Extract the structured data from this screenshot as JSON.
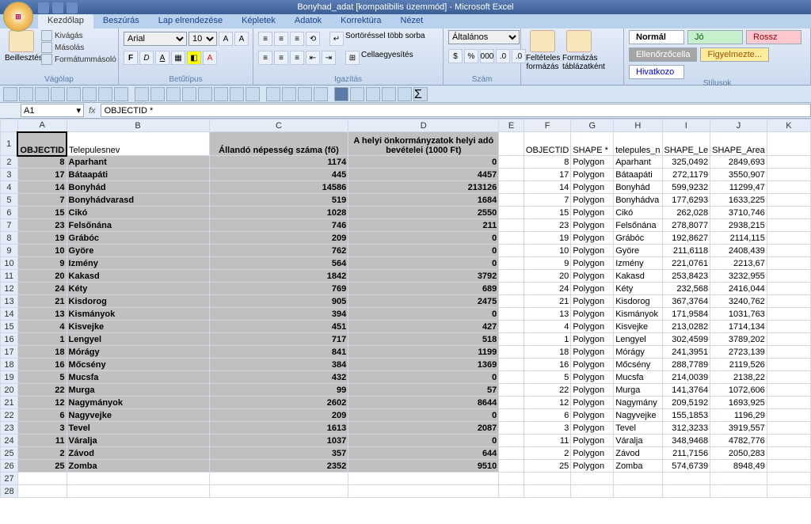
{
  "title": "Bonyhad_adat  [kompatibilis üzemmód] - Microsoft Excel",
  "tabs": [
    "Kezdőlap",
    "Beszúrás",
    "Lap elrendezése",
    "Képletek",
    "Adatok",
    "Korrektúra",
    "Nézet"
  ],
  "active_tab": "Kezdőlap",
  "clipboard": {
    "paste": "Beillesztés",
    "cut": "Kivágás",
    "copy": "Másolás",
    "fmt": "Formátummásoló",
    "label": "Vágólap"
  },
  "font": {
    "name": "Arial",
    "size": "10",
    "label": "Betűtípus"
  },
  "align": {
    "wrap": "Sortöréssel több sorba",
    "merge": "Cellaegyesítés",
    "label": "Igazítás"
  },
  "number": {
    "general": "Általános",
    "label": "Szám"
  },
  "styles": {
    "cond": "Feltételes formázás",
    "table": "Formázás táblázatként",
    "label": "Stílusok",
    "normal": "Normál",
    "jo": "Jó",
    "rossz": "Rossz",
    "ell": "Ellenőrzőcella",
    "fig": "Figyelmezte...",
    "hiv": "Hivatkozo"
  },
  "namebox": "A1",
  "formula": "OBJECTID *",
  "headers": {
    "A": "OBJECTID",
    "B": "Telepulesnev",
    "C": "Állandó népesség száma (fő)",
    "D": "A helyi önkormányzatok helyi adó bevételei (1000 Ft)",
    "F": "OBJECTID",
    "G": "SHAPE *",
    "H": "telepules_n",
    "I": "SHAPE_Le",
    "J": "SHAPE_Area"
  },
  "rows": [
    {
      "r": 2,
      "A": 8,
      "B": "Aparhant",
      "C": 1174,
      "D": 0,
      "F": 8,
      "G": "Polygon",
      "H": "Aparhant",
      "I": "325,0492",
      "J": "2849,693"
    },
    {
      "r": 3,
      "A": 17,
      "B": "Bátaapáti",
      "C": 445,
      "D": 4457,
      "F": 17,
      "G": "Polygon",
      "H": "Bátaapáti",
      "I": "272,1179",
      "J": "3550,907"
    },
    {
      "r": 4,
      "A": 14,
      "B": "Bonyhád",
      "C": 14586,
      "D": 213126,
      "F": 14,
      "G": "Polygon",
      "H": "Bonyhád",
      "I": "599,9232",
      "J": "11299,47"
    },
    {
      "r": 5,
      "A": 7,
      "B": "Bonyhádvarasd",
      "C": 519,
      "D": 1684,
      "F": 7,
      "G": "Polygon",
      "H": "Bonyhádva",
      "I": "177,6293",
      "J": "1633,225"
    },
    {
      "r": 6,
      "A": 15,
      "B": "Cikó",
      "C": 1028,
      "D": 2550,
      "F": 15,
      "G": "Polygon",
      "H": "Cikó",
      "I": "262,028",
      "J": "3710,746"
    },
    {
      "r": 7,
      "A": 23,
      "B": "Felsőnána",
      "C": 746,
      "D": 211,
      "F": 23,
      "G": "Polygon",
      "H": "Felsőnána",
      "I": "278,8077",
      "J": "2938,215"
    },
    {
      "r": 8,
      "A": 19,
      "B": "Grábóc",
      "C": 209,
      "D": 0,
      "F": 19,
      "G": "Polygon",
      "H": "Grábóc",
      "I": "192,8627",
      "J": "2114,115"
    },
    {
      "r": 9,
      "A": 10,
      "B": "Györe",
      "C": 762,
      "D": 0,
      "F": 10,
      "G": "Polygon",
      "H": "Györe",
      "I": "211,6118",
      "J": "2408,439"
    },
    {
      "r": 10,
      "A": 9,
      "B": "Izmény",
      "C": 564,
      "D": 0,
      "F": 9,
      "G": "Polygon",
      "H": "Izmény",
      "I": "221,0761",
      "J": "2213,67"
    },
    {
      "r": 11,
      "A": 20,
      "B": "Kakasd",
      "C": 1842,
      "D": 3792,
      "F": 20,
      "G": "Polygon",
      "H": "Kakasd",
      "I": "253,8423",
      "J": "3232,955"
    },
    {
      "r": 12,
      "A": 24,
      "B": "Kéty",
      "C": 769,
      "D": 689,
      "F": 24,
      "G": "Polygon",
      "H": "Kéty",
      "I": "232,568",
      "J": "2416,044"
    },
    {
      "r": 13,
      "A": 21,
      "B": "Kisdorog",
      "C": 905,
      "D": 2475,
      "F": 21,
      "G": "Polygon",
      "H": "Kisdorog",
      "I": "367,3764",
      "J": "3240,762"
    },
    {
      "r": 14,
      "A": 13,
      "B": "Kismányok",
      "C": 394,
      "D": 0,
      "F": 13,
      "G": "Polygon",
      "H": "Kismányok",
      "I": "171,9584",
      "J": "1031,763"
    },
    {
      "r": 15,
      "A": 4,
      "B": "Kisvejke",
      "C": 451,
      "D": 427,
      "F": 4,
      "G": "Polygon",
      "H": "Kisvejke",
      "I": "213,0282",
      "J": "1714,134"
    },
    {
      "r": 16,
      "A": 1,
      "B": "Lengyel",
      "C": 717,
      "D": 518,
      "F": 1,
      "G": "Polygon",
      "H": "Lengyel",
      "I": "302,4599",
      "J": "3789,202"
    },
    {
      "r": 17,
      "A": 18,
      "B": "Mórágy",
      "C": 841,
      "D": 1199,
      "F": 18,
      "G": "Polygon",
      "H": "Mórágy",
      "I": "241,3951",
      "J": "2723,139"
    },
    {
      "r": 18,
      "A": 16,
      "B": "Mőcsény",
      "C": 384,
      "D": 1369,
      "F": 16,
      "G": "Polygon",
      "H": "Mőcsény",
      "I": "288,7789",
      "J": "2119,526"
    },
    {
      "r": 19,
      "A": 5,
      "B": "Mucsfa",
      "C": 432,
      "D": 0,
      "F": 5,
      "G": "Polygon",
      "H": "Mucsfa",
      "I": "214,0039",
      "J": "2138,22"
    },
    {
      "r": 20,
      "A": 22,
      "B": "Murga",
      "C": 99,
      "D": 57,
      "F": 22,
      "G": "Polygon",
      "H": "Murga",
      "I": "141,3764",
      "J": "1072,606"
    },
    {
      "r": 21,
      "A": 12,
      "B": "Nagymányok",
      "C": 2602,
      "D": 8644,
      "F": 12,
      "G": "Polygon",
      "H": "Nagymány",
      "I": "209,5192",
      "J": "1693,925"
    },
    {
      "r": 22,
      "A": 6,
      "B": "Nagyvejke",
      "C": 209,
      "D": 0,
      "F": 6,
      "G": "Polygon",
      "H": "Nagyvejke",
      "I": "155,1853",
      "J": "1196,29"
    },
    {
      "r": 23,
      "A": 3,
      "B": "Tevel",
      "C": 1613,
      "D": 2087,
      "F": 3,
      "G": "Polygon",
      "H": "Tevel",
      "I": "312,3233",
      "J": "3919,557"
    },
    {
      "r": 24,
      "A": 11,
      "B": "Váralja",
      "C": 1037,
      "D": 0,
      "F": 11,
      "G": "Polygon",
      "H": "Váralja",
      "I": "348,9468",
      "J": "4782,776"
    },
    {
      "r": 25,
      "A": 2,
      "B": "Závod",
      "C": 357,
      "D": 644,
      "F": 2,
      "G": "Polygon",
      "H": "Závod",
      "I": "211,7156",
      "J": "2050,283"
    },
    {
      "r": 26,
      "A": 25,
      "B": "Zomba",
      "C": 2352,
      "D": 9510,
      "F": 25,
      "G": "Polygon",
      "H": "Zomba",
      "I": "574,6739",
      "J": "8948,49"
    }
  ]
}
